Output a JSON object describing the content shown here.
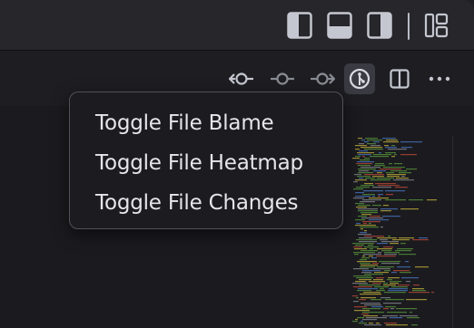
{
  "titlebar": {
    "icons": [
      {
        "name": "toggle-primary-sidebar-icon"
      },
      {
        "name": "toggle-panel-icon"
      },
      {
        "name": "toggle-secondary-sidebar-icon"
      },
      {
        "name": "customize-layout-icon"
      }
    ]
  },
  "editor_actions": {
    "icons": [
      {
        "name": "previous-change-icon"
      },
      {
        "name": "current-change-icon"
      },
      {
        "name": "next-change-icon"
      },
      {
        "name": "gitlens-toggle-icon",
        "active": true
      },
      {
        "name": "split-editor-icon"
      },
      {
        "name": "more-actions-icon"
      }
    ]
  },
  "context_menu": {
    "items": [
      {
        "label": "Toggle File Blame"
      },
      {
        "label": "Toggle File Heatmap"
      },
      {
        "label": "Toggle File Changes"
      }
    ]
  },
  "colors": {
    "icon": "#c5c7d0",
    "menu_text": "#e6e6ea",
    "menu_border": "#505058",
    "minimap_green": "#5a9a3c",
    "minimap_yellow": "#c8b43c",
    "minimap_red": "#c04a3a",
    "minimap_blue": "#4a7ac8"
  }
}
